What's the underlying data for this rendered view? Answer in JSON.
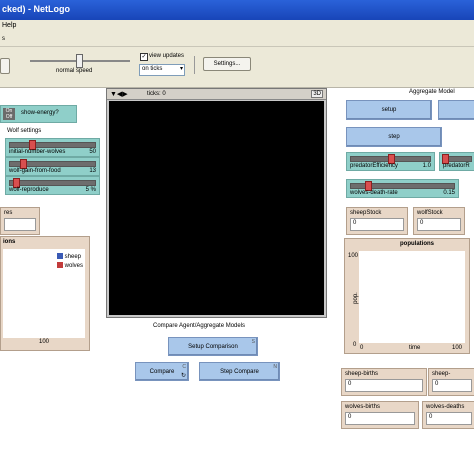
{
  "window": {
    "title": "cked) - NetLogo"
  },
  "menubar": {
    "help": "Help"
  },
  "toolbar1": {
    "tab": "s"
  },
  "speed": {
    "label": "normal speed"
  },
  "view_updates": {
    "label": "view updates",
    "checked": true,
    "mode": "on ticks"
  },
  "settings_button": "Settings...",
  "world": {
    "ticks_label": "ticks: 0",
    "zoom": "3D"
  },
  "switch_show_energy": {
    "on": "On",
    "off": "Off",
    "label": "show-energy?"
  },
  "wolf_settings": {
    "title": "Wolf settings"
  },
  "sliders": [
    {
      "label": "initial-number-wolves",
      "value": "50",
      "fraction": 0.25
    },
    {
      "label": "wolf-gain-from-food",
      "value": "13",
      "fraction": 0.13
    },
    {
      "label": "wolf-reproduce",
      "value": "5 %",
      "fraction": 0.05
    }
  ],
  "left_monitor": {
    "label": "res"
  },
  "left_plot": {
    "title": "ions",
    "x_end": "100",
    "legend": [
      {
        "name": "sheep",
        "color": "#3a5ab5"
      },
      {
        "name": "wolves",
        "color": "#c23b3b"
      }
    ]
  },
  "compare": {
    "title": "Compare Agent/Aggregate Models",
    "setup": "Setup Comparison",
    "setup_key": "S",
    "compare": "Compare",
    "compare_key": "C",
    "step": "Step Compare",
    "step_key": "N"
  },
  "aggregate": {
    "title": "Aggregate Model",
    "setup": "setup",
    "step": "step",
    "slider_pred": {
      "label": "predatorEfficiency",
      "value": "1.0",
      "fraction": 0.5
    },
    "slider_prey": {
      "label": "predatorR"
    },
    "slider_wdr": {
      "label": "wolves-death-rate",
      "value": "0.15",
      "fraction": 0.15
    },
    "monitors": [
      {
        "label": "sheepStock",
        "value": "0"
      },
      {
        "label": "wolfStock",
        "value": "0"
      }
    ],
    "plot": {
      "title": "populations",
      "y_max": "100",
      "y_min": "0",
      "x_min": "0",
      "x_max": "100",
      "xlabel": "time",
      "ylabel": "pop."
    },
    "monitors2": [
      {
        "label": "sheep-births",
        "value": "0"
      },
      {
        "label": "sheep-",
        "value": "0"
      },
      {
        "label": "wolves-births",
        "value": "0"
      },
      {
        "label": "wolves-deaths",
        "value": "0"
      }
    ]
  }
}
